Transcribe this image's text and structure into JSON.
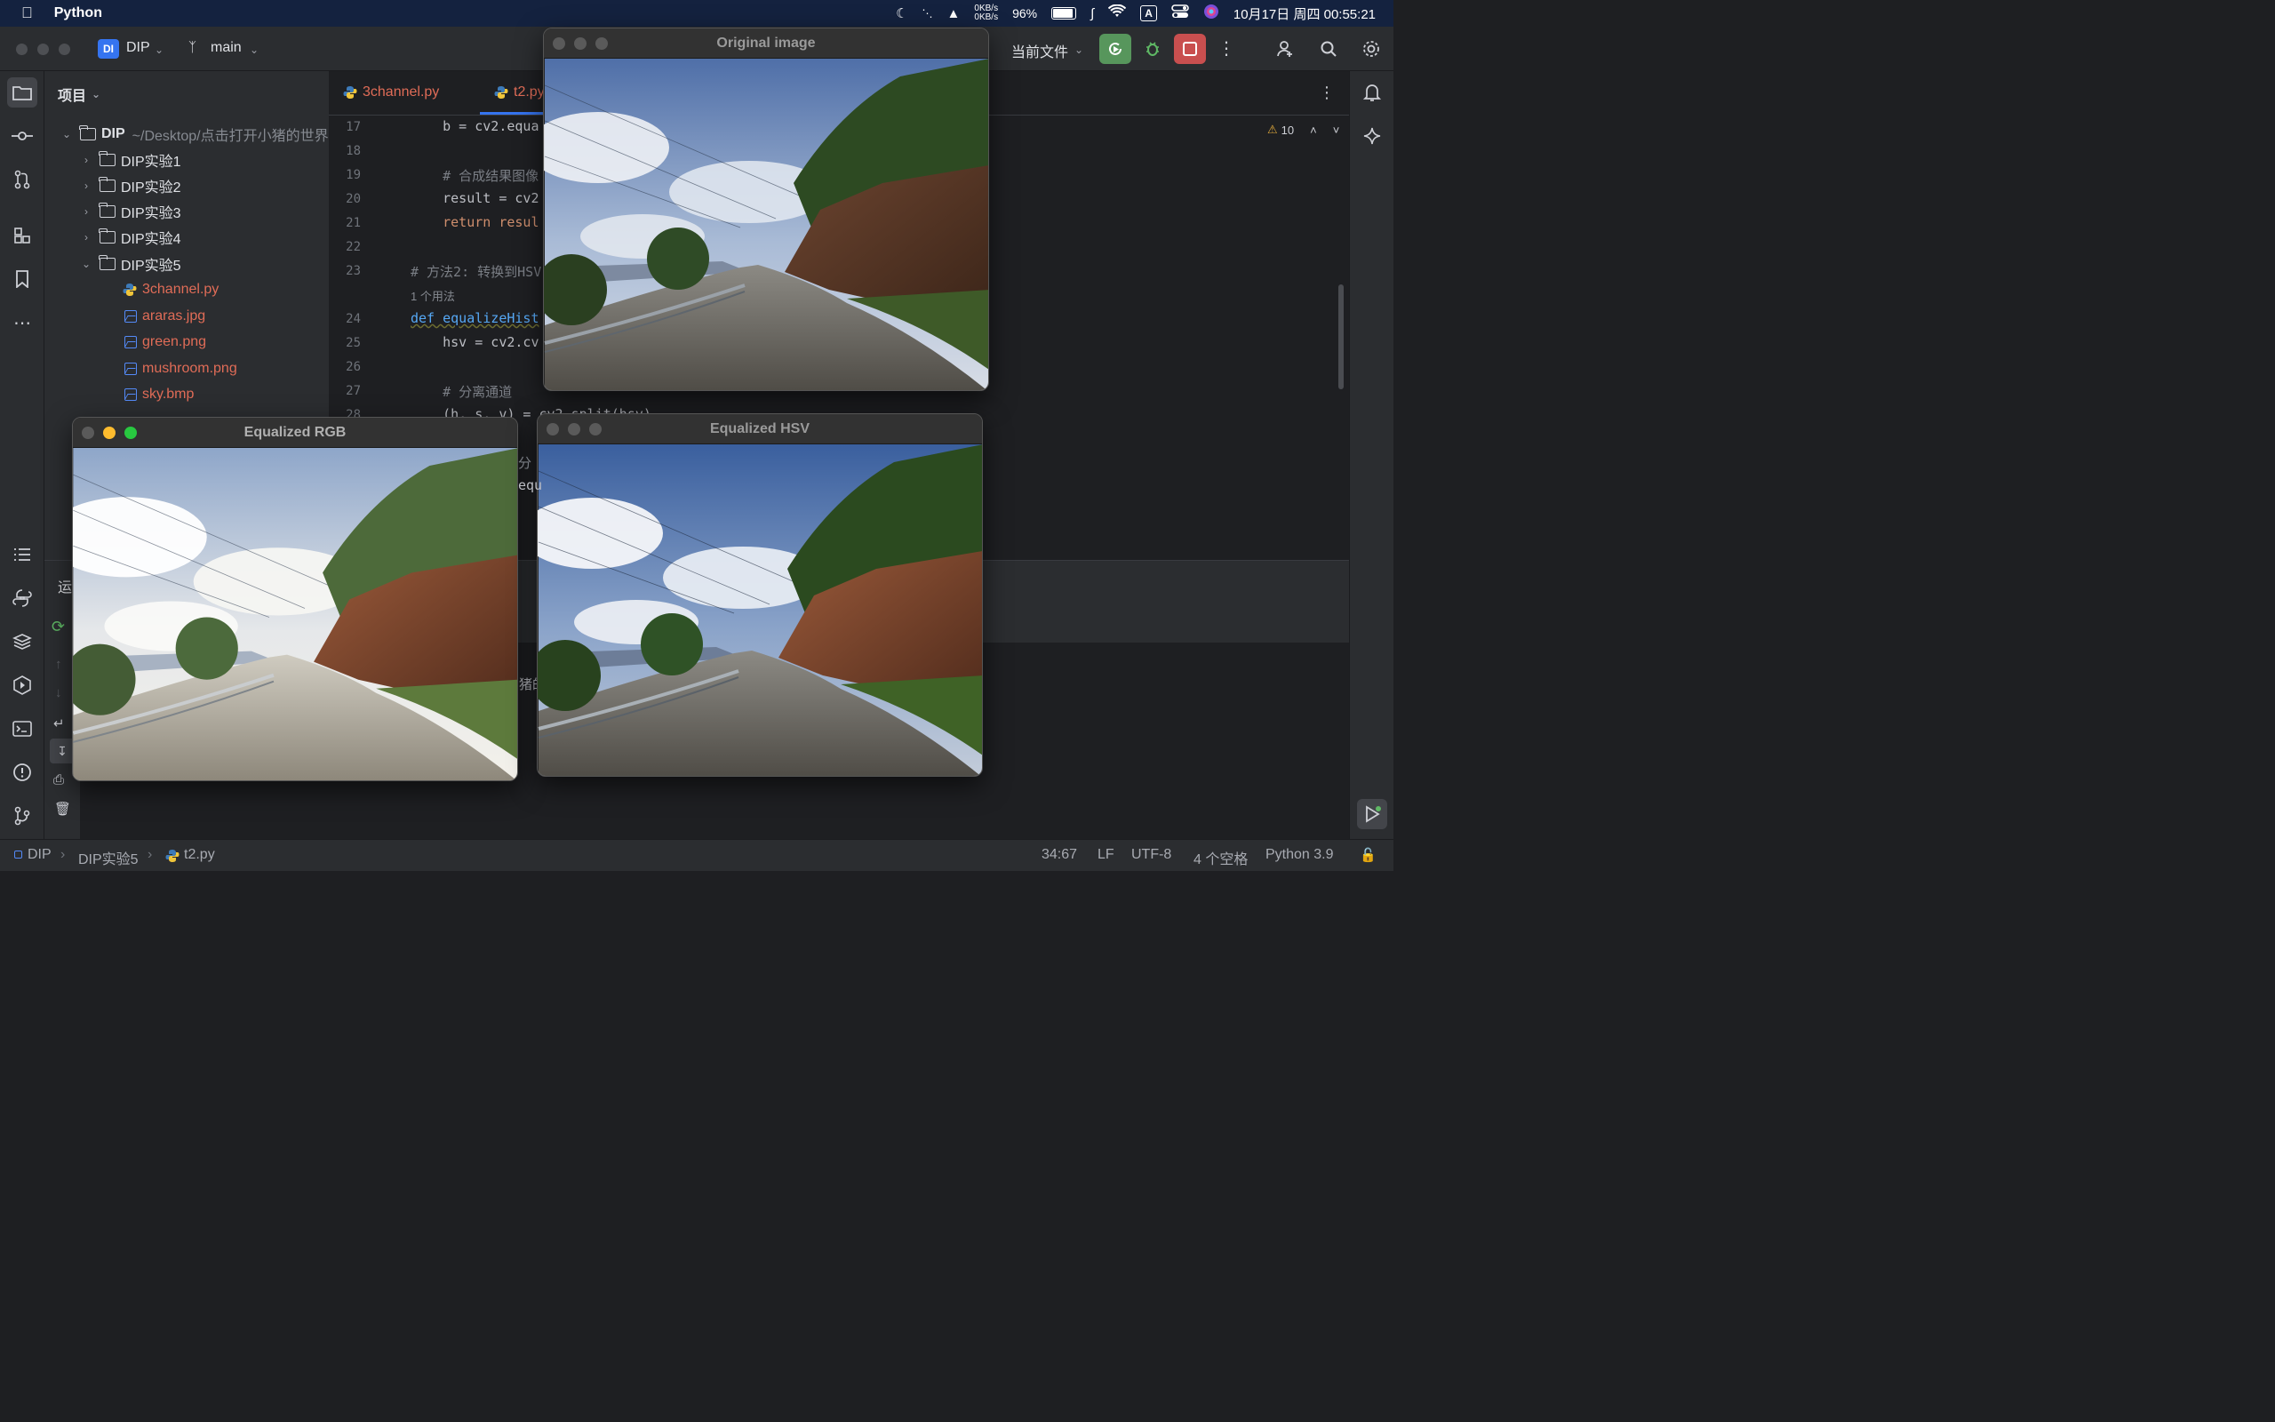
{
  "menubar": {
    "app_name": "Python",
    "net_up": "0KB/s",
    "net_down": "0KB/s",
    "battery": "96%",
    "input_method": "A",
    "datetime": "10月17日 周四  00:55:21"
  },
  "titlebar": {
    "project_badge": "DI",
    "project_name": "DIP",
    "branch": "main",
    "run_config": "当前文件"
  },
  "project_panel": {
    "title": "项目",
    "root_name": "DIP",
    "root_path": "~/Desktop/点击打开小猪的世界",
    "folders": [
      "DIP实验1",
      "DIP实验2",
      "DIP实验3",
      "DIP实验4",
      "DIP实验5"
    ],
    "files": [
      "3channel.py",
      "araras.jpg",
      "green.png",
      "mushroom.png",
      "sky.bmp"
    ]
  },
  "editor": {
    "tabs": [
      "3channel.py",
      "t2.py"
    ],
    "warnings": "10",
    "lines": [
      {
        "num": "17",
        "text": "    b = cv2.equa"
      },
      {
        "num": "18",
        "text": ""
      },
      {
        "num": "19",
        "text": "    # 合成结果图像"
      },
      {
        "num": "20",
        "text": "    result = cv2"
      },
      {
        "num": "21",
        "text": "    return resul"
      },
      {
        "num": "22",
        "text": ""
      },
      {
        "num": "23",
        "text": "# 方法2: 转换到HSV"
      },
      {
        "num": "",
        "text": "1 个用法"
      },
      {
        "num": "24",
        "text": "def equalizeHist"
      },
      {
        "num": "25",
        "text": "    hsv = cv2.cv"
      },
      {
        "num": "26",
        "text": ""
      },
      {
        "num": "27",
        "text": "    # 分离通道"
      },
      {
        "num": "28",
        "text": "    (h, s, v) = cv2.split(hsv)"
      }
    ],
    "partial_fragments": [
      "分",
      "equ",
      "猪的"
    ]
  },
  "bottom_panel": {
    "tab_label": "运"
  },
  "windows": {
    "original": "Original image",
    "rgb": "Equalized RGB",
    "hsv": "Equalized HSV"
  },
  "statusbar": {
    "crumb_root": "DIP",
    "crumb_folder": "DIP实验5",
    "crumb_file": "t2.py",
    "position": "34:67",
    "line_sep": "LF",
    "encoding": "UTF-8",
    "indent": "4 个空格",
    "interpreter": "Python 3.9"
  }
}
